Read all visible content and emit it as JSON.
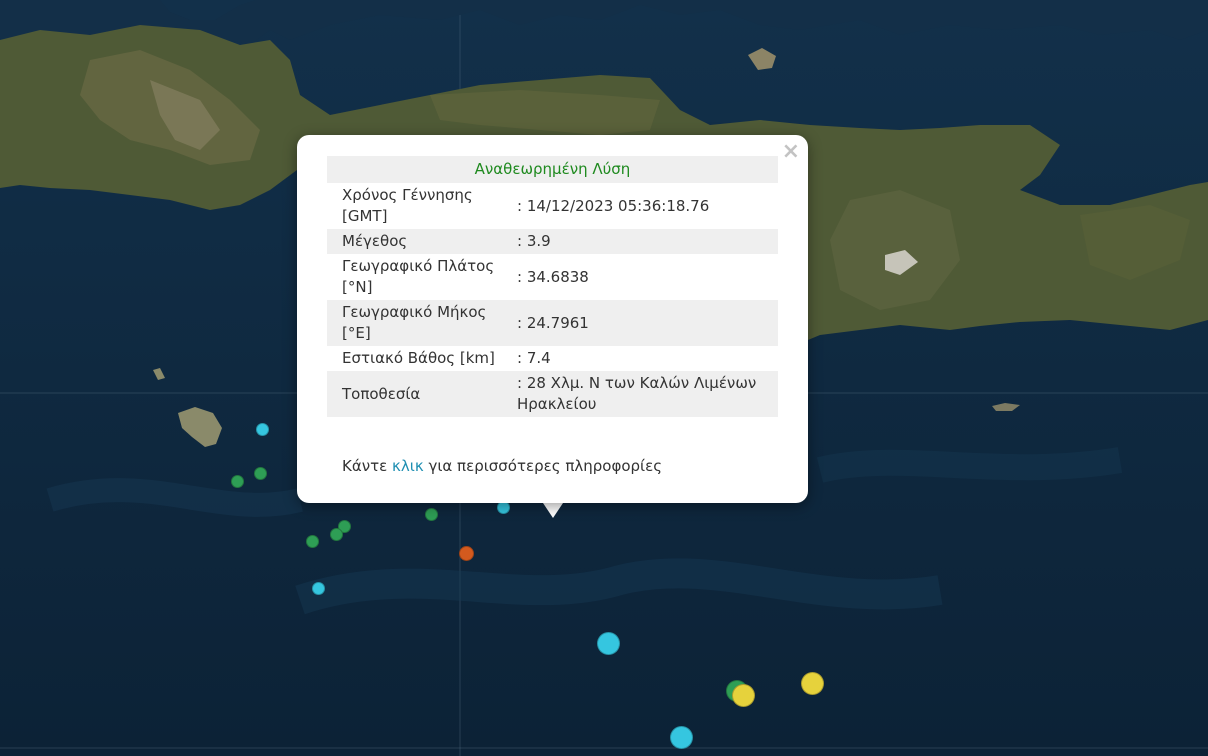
{
  "popup": {
    "title": "Αναθεωρημένη Λύση",
    "close_symbol": "×",
    "rows": [
      {
        "label": "Χρόνος Γέννησης [GMT]",
        "value": ": 14/12/2023 05:36:18.76"
      },
      {
        "label": "Μέγεθος",
        "value": ": 3.9"
      },
      {
        "label": "Γεωγραφικό Πλάτος [°N]",
        "value": ": 34.6838"
      },
      {
        "label": "Γεωγραφικό Μήκος [°E]",
        "value": ": 24.7961"
      },
      {
        "label": "Εστιακό Βάθος [km]",
        "value": ": 7.4"
      },
      {
        "label": "Τοποθεσία",
        "value": ": 28 Χλμ. Ν των Καλών Λιμένων Ηρακλείου"
      }
    ],
    "more_prefix": "Κάντε",
    "more_link": "κλικ",
    "more_suffix": "για περισσότερες πληροφορίες"
  },
  "colors": {
    "sea": "#0f2a41",
    "land": "#4f5a36",
    "title_green": "#1f8a1f",
    "link_blue": "#1f8fb2",
    "event_cyan": "#35c6e0",
    "event_green": "#2e9e55",
    "event_yellow": "#e6d23c",
    "event_orange": "#d35a1e"
  },
  "icons": {
    "close": "close-icon",
    "event": "earthquake-marker"
  }
}
